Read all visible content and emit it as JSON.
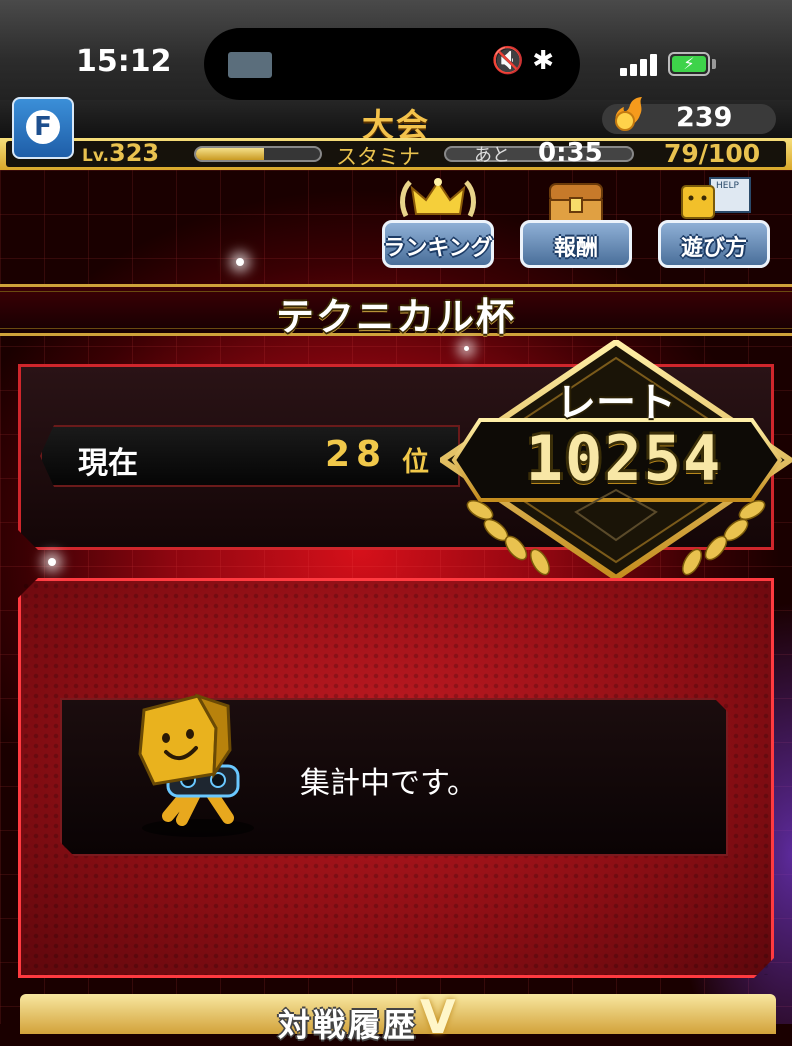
{
  "status_bar": {
    "time": "15:12",
    "island_icons": "🔇 ✱",
    "battery_icon": "⚡"
  },
  "header": {
    "title": "大会",
    "coins": "239",
    "level_prefix": "Lv.",
    "level": "323",
    "level_progress": 0.55,
    "stamina_label": "スタミナ",
    "stamina_remaining_label": "あと",
    "stamina_timer": "0:35",
    "stamina": "79/100"
  },
  "top_buttons": [
    {
      "label": "ランキング",
      "icon": "crown-icon"
    },
    {
      "label": "報酬",
      "icon": "treasure-chest-icon"
    },
    {
      "label": "遊び方",
      "icon": "help-mascot-icon",
      "badge": "HELP"
    }
  ],
  "tournament": {
    "name": "テクニカル杯",
    "current_label": "現在",
    "rank": "28",
    "rank_unit": "位",
    "rate_label": "レート",
    "rate_value": "10254"
  },
  "message": {
    "text": "集計中です。"
  },
  "bottom_tab": {
    "label": "対戦履歴",
    "emblem": "V"
  },
  "colors": {
    "gold": "#f1c84a",
    "red_border": "#d0262c",
    "button_blue": "#4a6f9a"
  }
}
